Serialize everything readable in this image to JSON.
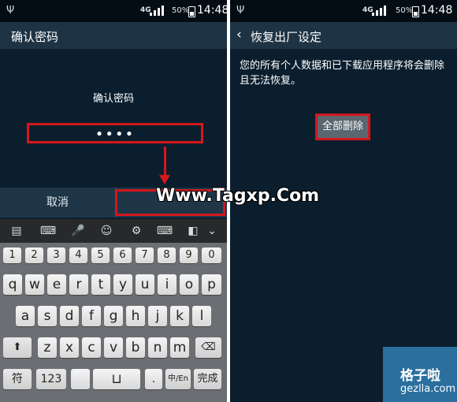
{
  "status_bar": {
    "network": "4G",
    "battery": "50%",
    "time": "14:48"
  },
  "left_screen": {
    "title": "确认密码",
    "prompt": "确认密码",
    "password_value": "••••",
    "cancel_label": "取消",
    "keyboard": {
      "numbers": [
        "1",
        "2",
        "3",
        "4",
        "5",
        "6",
        "7",
        "8",
        "9",
        "0"
      ],
      "row1": [
        "q",
        "w",
        "e",
        "r",
        "t",
        "y",
        "u",
        "i",
        "o",
        "p"
      ],
      "row2": [
        "a",
        "s",
        "d",
        "f",
        "g",
        "h",
        "j",
        "k",
        "l"
      ],
      "row3": [
        "z",
        "x",
        "c",
        "v",
        "b",
        "n",
        "m"
      ],
      "symbol_label": "符",
      "numeric_label": "123",
      "period_label": ".",
      "lang_label": "中/En",
      "done_label": "完成"
    }
  },
  "right_screen": {
    "title": "恢复出厂设定",
    "description": "您的所有个人数据和已下载应用程序将会删除且无法恢复。",
    "delete_all_label": "全部删除"
  },
  "overlay": {
    "watermark": "Www.Tagxp.Com",
    "corner_logo_cn": "格子啦",
    "corner_logo_en": "gezlla.com"
  },
  "colors": {
    "highlight": "#d3171c",
    "screen_bg": "#0a1e2e",
    "actionbar": "#1e3445"
  },
  "icons": [
    "usb-icon",
    "signal-icon",
    "battery-icon",
    "back-arrow-icon",
    "clipboard-icon",
    "keyboard-icon",
    "mic-icon",
    "emoji-icon",
    "settings-icon",
    "keyboard-settings-icon",
    "split-keyboard-icon",
    "hide-keyboard-icon",
    "shift-icon",
    "backspace-icon",
    "space-bar-icon"
  ]
}
